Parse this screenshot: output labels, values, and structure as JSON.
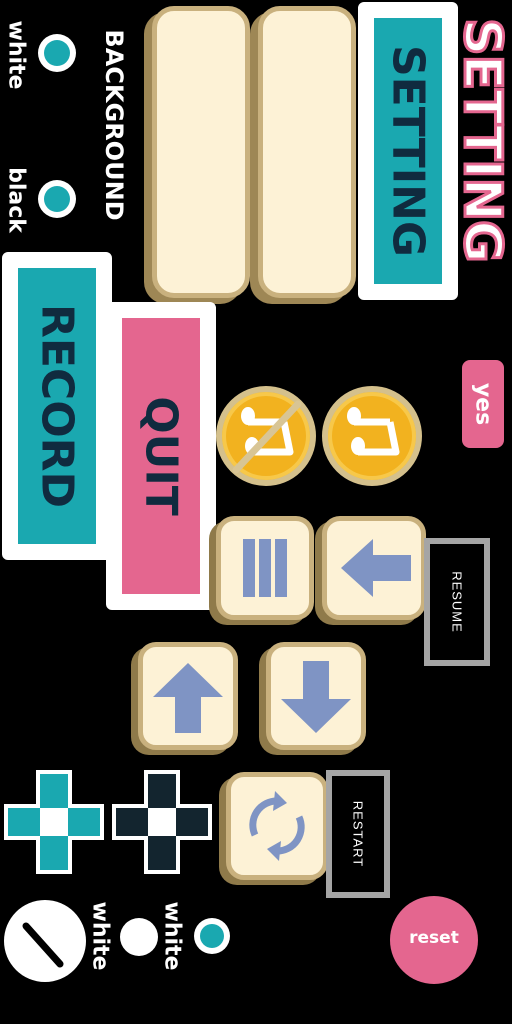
{
  "title": "SETTING",
  "setting_button": "SETTING",
  "background_section": {
    "heading": "BACKGROUND",
    "options": [
      {
        "label": "white",
        "selected": true
      },
      {
        "label": "black",
        "selected": false
      }
    ]
  },
  "record_button": "RECORD",
  "quit_button": "QUIT",
  "yes_button": "yes",
  "resume_button": "RESUME",
  "restart_button": "RESTART",
  "reset_button": "reset",
  "color_options": [
    {
      "label": "white",
      "selected": true
    },
    {
      "label": "white",
      "selected": false
    }
  ],
  "icons": {
    "music_off": "music-off-icon",
    "music_on": "music-on-icon",
    "menu": "menu-bars-icon",
    "back": "arrow-left-icon",
    "up": "arrow-up-icon",
    "down": "arrow-down-icon",
    "refresh": "refresh-icon",
    "dpad_light": "dpad-teal-icon",
    "dpad_dark": "dpad-dark-icon",
    "dial": "dial-icon"
  },
  "colors": {
    "teal": "#1aa8b0",
    "pink": "#e4668f",
    "cream": "#fdf2d6",
    "coin": "#f2b21f",
    "arrow": "#7f94c4"
  }
}
